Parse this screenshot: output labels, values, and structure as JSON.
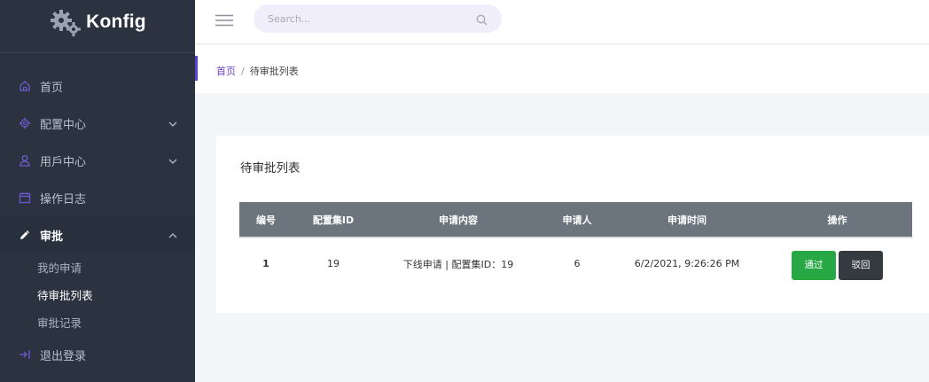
{
  "brand": {
    "name": "Konfig"
  },
  "sidebar": {
    "items": [
      {
        "label": "首页",
        "icon": "home-icon"
      },
      {
        "label": "配置中心",
        "icon": "gear-icon"
      },
      {
        "label": "用戶中心",
        "icon": "user-icon"
      },
      {
        "label": "操作日志",
        "icon": "calendar-icon"
      },
      {
        "label": "审批",
        "icon": "pencil-icon"
      }
    ],
    "subitems": [
      {
        "label": "我的申请"
      },
      {
        "label": "待审批列表"
      },
      {
        "label": "审批记录"
      }
    ],
    "logout": {
      "label": "退出登录",
      "icon": "logout-icon"
    }
  },
  "topbar": {
    "search_placeholder": "Search..."
  },
  "breadcrumb": {
    "home": "首页",
    "separator": "/",
    "current": "待审批列表"
  },
  "card": {
    "title": "待审批列表",
    "table": {
      "headers": [
        "编号",
        "配置集ID",
        "申请内容",
        "申请人",
        "申请时间",
        "操作"
      ],
      "rows": [
        {
          "id": "1",
          "config_id": "19",
          "content": "下线申请 | 配置集ID：19",
          "applicant": "6",
          "time": "6/2/2021, 9:26:26 PM"
        }
      ]
    },
    "actions": {
      "approve": "通过",
      "reject": "驳回"
    }
  },
  "colors": {
    "sidebar_bg": "#2b3340",
    "accent": "#5b3fd6",
    "approve": "#28a745",
    "reject": "#343a40",
    "table_header": "#6c757d"
  }
}
